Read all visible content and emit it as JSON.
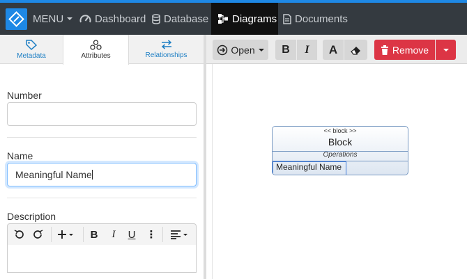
{
  "navbar": {
    "menu_label": "MENU",
    "items": [
      {
        "label": "Dashboard",
        "icon": "dashboard-icon"
      },
      {
        "label": "Database",
        "icon": "database-icon"
      },
      {
        "label": "Diagrams",
        "icon": "diagram-icon",
        "active": true
      },
      {
        "label": "Documents",
        "icon": "document-icon"
      }
    ],
    "accent_color": "#1e88e5"
  },
  "left_panel": {
    "tabs": [
      {
        "label": "Metadata",
        "icon": "tag-icon"
      },
      {
        "label": "Attributes",
        "icon": "shapes-icon",
        "active": true
      },
      {
        "label": "Relationships",
        "icon": "swap-arrows-icon"
      }
    ],
    "fields": {
      "number_label": "Number",
      "number_value": "",
      "name_label": "Name",
      "name_value": "Meaningful Name",
      "description_label": "Description"
    },
    "editor_toolbar": [
      "undo-icon",
      "redo-icon",
      "insert-icon",
      "bold-icon",
      "italic-icon",
      "underline-icon",
      "more-icon",
      "align-icon"
    ]
  },
  "right_panel": {
    "toolbar": {
      "open_label": "Open",
      "bold": "B",
      "italic": "I",
      "font": "A",
      "remove_label": "Remove",
      "danger_color": "#dc3545"
    },
    "block": {
      "stereotype": "<< block >>",
      "name": "Block",
      "operations_label": "Operations",
      "attribute": "Meaningful Name"
    }
  }
}
